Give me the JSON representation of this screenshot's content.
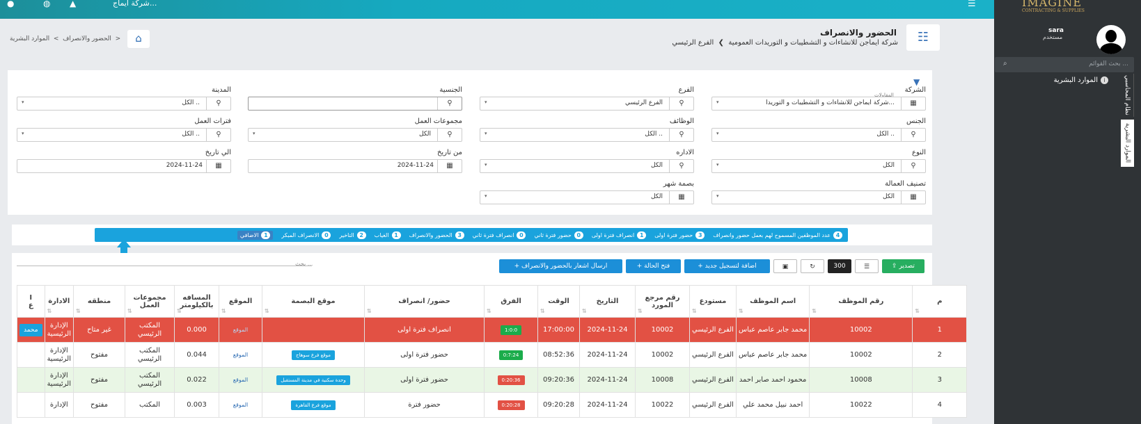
{
  "topbar": {
    "company": "شركة ايماج...",
    "icons": [
      "user-icon",
      "globe-icon",
      "bell-icon",
      "menu-icon"
    ]
  },
  "sidebar": {
    "logo": "IMAGINE",
    "logo_sub": "CONTRACTING & SUPPLIES",
    "user_name": "sara",
    "user_role": "مستخدم",
    "search_placeholder": "بحث القوائم ...",
    "item": "الموارد البشرية",
    "tab1": "نظام المحاسبي",
    "tab2": "الموارد البشرية"
  },
  "header": {
    "title": "الحضور والانصراف",
    "company": "شركة ايماجن للانشاءات و التشطيبات و التوريدات العمومية",
    "branch": "الفرع الرئيسي",
    "bc1": "الموارد البشرية",
    "bc2": "الحضور والانصراف"
  },
  "filters": {
    "company_label": "الشركة",
    "company_sub": "المقاولات",
    "company_val": "شركة ايماجن للانشاءات و التشطيبات و التوريدا...",
    "branch_label": "الفرع",
    "branch_val": "الفرع الرئيسي",
    "nationality_label": "الجنسية",
    "nationality_val": "",
    "city_label": "المدينة",
    "city_val": "الكل ..",
    "gender_label": "الجنس",
    "gender_val": "الكل ..",
    "jobs_label": "الوظائف",
    "jobs_val": "الكل ..",
    "workgroups_label": "مجموعات العمل",
    "workgroups_val": "الكل",
    "workperiods_label": "فترات العمل",
    "workperiods_val": "الكل ..",
    "type_label": "النوع",
    "type_val": "الكل",
    "admin_label": "الاداره",
    "admin_val": "الكل",
    "from_label": "من تاريخ",
    "from_val": "2024-11-24",
    "to_label": "الي تاريخ",
    "to_val": "2024-11-24",
    "labor_label": "تصنيف العمالة",
    "labor_val": "الكل",
    "fingerprint_label": "بصمة شهر",
    "fingerprint_val": "الكل"
  },
  "counts": [
    {
      "label": "عدد الموظفين المسموح لهم بعمل حضور وانصراف",
      "n": "4"
    },
    {
      "label": "حضور فترة اولى",
      "n": "3"
    },
    {
      "label": "انصراف فترة اولى",
      "n": "1"
    },
    {
      "label": "حضور فترة ثاني",
      "n": "0"
    },
    {
      "label": "انصراف فترة ثاني",
      "n": "0"
    },
    {
      "label": "الحضور والانصراف",
      "n": "3"
    },
    {
      "label": "الغياب",
      "n": "1"
    },
    {
      "label": "التاخير",
      "n": "2"
    },
    {
      "label": "الانصراف المبكر",
      "n": "0"
    },
    {
      "label": "الاضافي",
      "n": "1"
    }
  ],
  "toolbar": {
    "export": "تصدير",
    "page_size": "300",
    "add_new": "اضافة لتسجيل جديد",
    "open_case": "فتح الحالة",
    "send_notice": "ارسال اشعار بالحضور والانصراف",
    "search_placeholder": "بحث ..."
  },
  "table": {
    "headers": [
      "م",
      "رقم الموظف",
      "اسم الموظف",
      "مستودع",
      "رقم مرجع المورد",
      "التاريخ",
      "الوقت",
      "الفرق",
      "حضور/ انصراف",
      "موقع البصمة",
      "الموقع",
      "المسافه بالكيلومتر",
      "مجموعات العمل",
      "منطقه",
      "الادارة"
    ],
    "rows": [
      {
        "n": "1",
        "emp": "10002",
        "name": "محمد جابر عاصم عباس",
        "store": "الفرع الرئيسي",
        "ref": "10002",
        "date": "2024-11-24",
        "time": "17:00:00",
        "diff": "1:0:0",
        "type": "انصراف فترة اولى",
        "place": "",
        "loc": "الموقع",
        "km": "0.000",
        "group": "المكتب الرئيسي",
        "zone": "غير متاح",
        "dept": "الإدارة الرئيسية"
      },
      {
        "n": "2",
        "emp": "10002",
        "name": "محمد جابر عاصم عباس",
        "store": "الفرع الرئيسي",
        "ref": "10002",
        "date": "2024-11-24",
        "time": "08:52:36",
        "diff": "0:7:24",
        "type": "حضور فترة اولى",
        "place": "موقع فرع سوهاج",
        "loc": "الموقع",
        "km": "0.044",
        "group": "المكتب الرئيسي",
        "zone": "مفتوح",
        "dept": "الإدارة الرئيسية"
      },
      {
        "n": "3",
        "emp": "10008",
        "name": "محمود احمد صابر احمد",
        "store": "الفرع الرئيسي",
        "ref": "10008",
        "date": "2024-11-24",
        "time": "09:20:36",
        "diff": "0:20:36",
        "type": "حضور فترة اولى",
        "place": "وحدة سكنية في مدينة المستقبل",
        "loc": "الموقع",
        "km": "0.022",
        "group": "المكتب الرئيسي",
        "zone": "مفتوح",
        "dept": "الإدارة الرئيسية"
      },
      {
        "n": "4",
        "emp": "10022",
        "name": "احمد نبيل محمد علي",
        "store": "الفرع الرئيسي",
        "ref": "10022",
        "date": "2024-11-24",
        "time": "09:20:28",
        "diff": "0:20:28",
        "type": "حضور فترة",
        "place": "موقع فرع القاهرة",
        "loc": "الموقع",
        "km": "0.003",
        "group": "المكتب",
        "zone": "مفتوح",
        "dept": "الإدارة"
      }
    ],
    "edge_btn": "محمد"
  },
  "colors": {
    "accent": "#1aa3dd",
    "red_row": "#e25144",
    "green_row": "#e9f6e5",
    "export": "#27ae60"
  }
}
